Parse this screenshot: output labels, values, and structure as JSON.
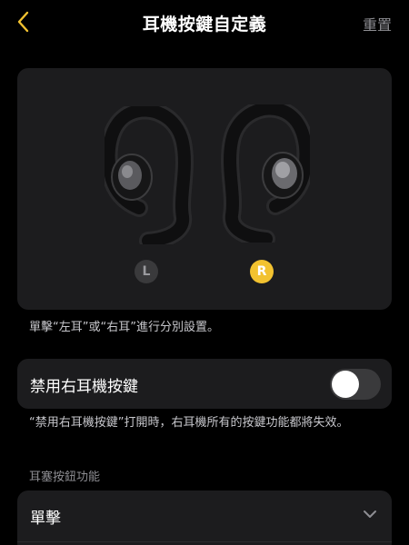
{
  "header": {
    "title": "耳機按鍵自定義",
    "reset_label": "重置"
  },
  "earbuds": {
    "left_label": "L",
    "right_label": "R",
    "selected": "R",
    "hint": "單擊“左耳”或“右耳”進行分別設置。"
  },
  "disable_row": {
    "label": "禁用右耳機按鍵",
    "enabled": false,
    "description": "“禁用右耳機按鍵”打開時，右耳機所有的按鍵功能都將失效。"
  },
  "buttons_section": {
    "label": "耳塞按鈕功能",
    "items": [
      {
        "label": "單擊"
      }
    ]
  },
  "colors": {
    "accent": "#f2c230",
    "background": "#000000",
    "card": "#1c1c1e",
    "toggle_off": "#3a3a3c"
  },
  "icons": {
    "back": "chevron-left-icon",
    "expand": "chevron-down-icon"
  }
}
